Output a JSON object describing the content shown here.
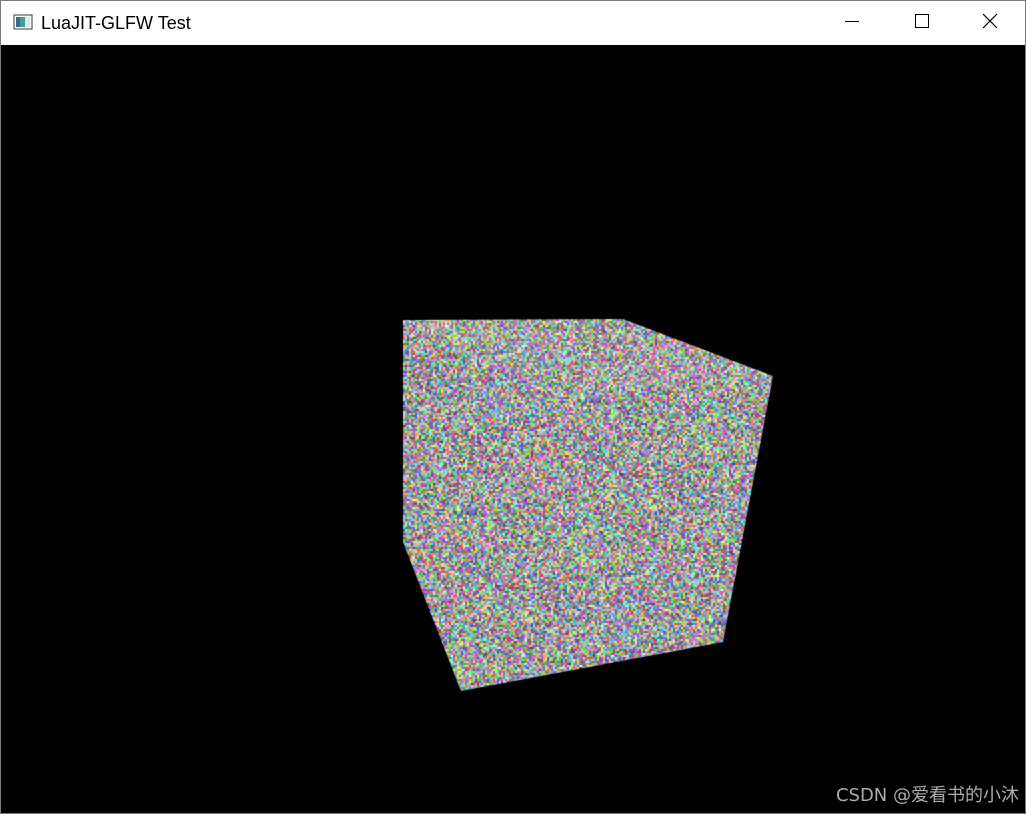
{
  "window": {
    "title": "LuaJIT-GLFW Test",
    "app_icon": "window-app-icon",
    "controls": {
      "minimize_icon": "minimize-icon",
      "maximize_icon": "maximize-icon",
      "close_icon": "close-icon"
    }
  },
  "viewport": {
    "background_color": "#000000",
    "object": "noise-textured-cube"
  },
  "watermark": {
    "text": "CSDN @爱看书的小沐"
  }
}
